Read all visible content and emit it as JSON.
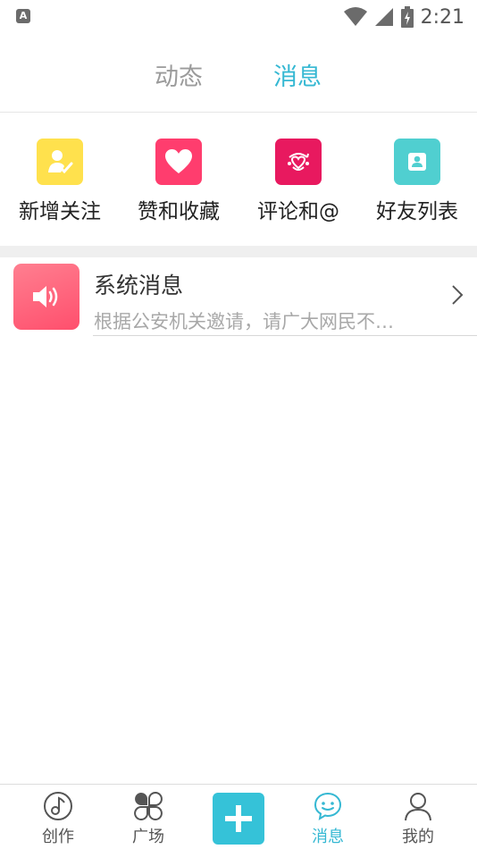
{
  "status_bar": {
    "time": "2:21",
    "left_badge": "A",
    "icons": [
      "wifi-icon",
      "signal-icon",
      "battery-charging-icon"
    ]
  },
  "top_tabs": {
    "dynamic": "动态",
    "messages": "消息",
    "active": "messages"
  },
  "quick_actions": [
    {
      "label": "新增关注",
      "icon": "new-follower-icon",
      "color": "#ffe14d"
    },
    {
      "label": "赞和收藏",
      "icon": "heart-icon",
      "color": "#ff3d6e"
    },
    {
      "label": "评论和@",
      "icon": "comment-icon",
      "color": "#e8195f"
    },
    {
      "label": "好友列表",
      "icon": "friend-list-icon",
      "color": "#50cfd0"
    }
  ],
  "messages": [
    {
      "title": "系统消息",
      "preview": "根据公安机关邀请，请广大网民不…",
      "icon": "speaker-icon"
    }
  ],
  "bottom_nav": {
    "create": "创作",
    "square": "广场",
    "add": "add-icon",
    "messages": "消息",
    "me": "我的",
    "active": "messages"
  },
  "colors": {
    "accent": "#35b8d3",
    "inactive_tab": "#9b9b9b"
  }
}
